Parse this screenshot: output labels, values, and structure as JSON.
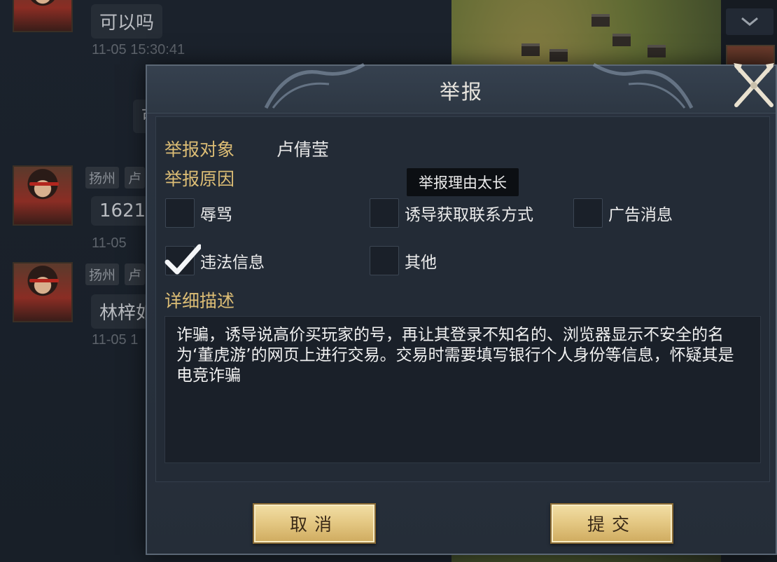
{
  "background_chat": {
    "messages": [
      {
        "text": "可以吗",
        "time": "11-05 15:30:41"
      },
      {
        "city": "扬州",
        "name_partial": "卢",
        "text_partial": "1621",
        "time_partial": "11-05"
      },
      {
        "city": "扬州",
        "name_partial": "卢",
        "text_partial": "林梓如",
        "time_partial": "11-05 1"
      }
    ],
    "hidden_bubble_partial": "可"
  },
  "side_panel": {
    "collapse_icon": "chevron-down-icon"
  },
  "dialog": {
    "title": "举报",
    "target_label": "举报对象",
    "target_name": "卢倩莹",
    "reason_label": "举报原因",
    "tooltip": "举报理由太长",
    "options": [
      {
        "label": "辱骂",
        "checked": false
      },
      {
        "label": "诱导获取联系方式",
        "checked": false
      },
      {
        "label": "广告消息",
        "checked": false
      },
      {
        "label": "违法信息",
        "checked": true
      },
      {
        "label": "其他",
        "checked": false
      }
    ],
    "detail_label": "详细描述",
    "description": "诈骗，诱导说高价买玩家的号，再让其登录不知名的、浏览器显示不安全的名为‘董虎游’的网页上进行交易。交易时需要填写银行个人身份等信息，怀疑其是电竞诈骗",
    "cancel_label": "取消",
    "submit_label": "提交",
    "close_icon": "crossed-swords-close-icon"
  }
}
